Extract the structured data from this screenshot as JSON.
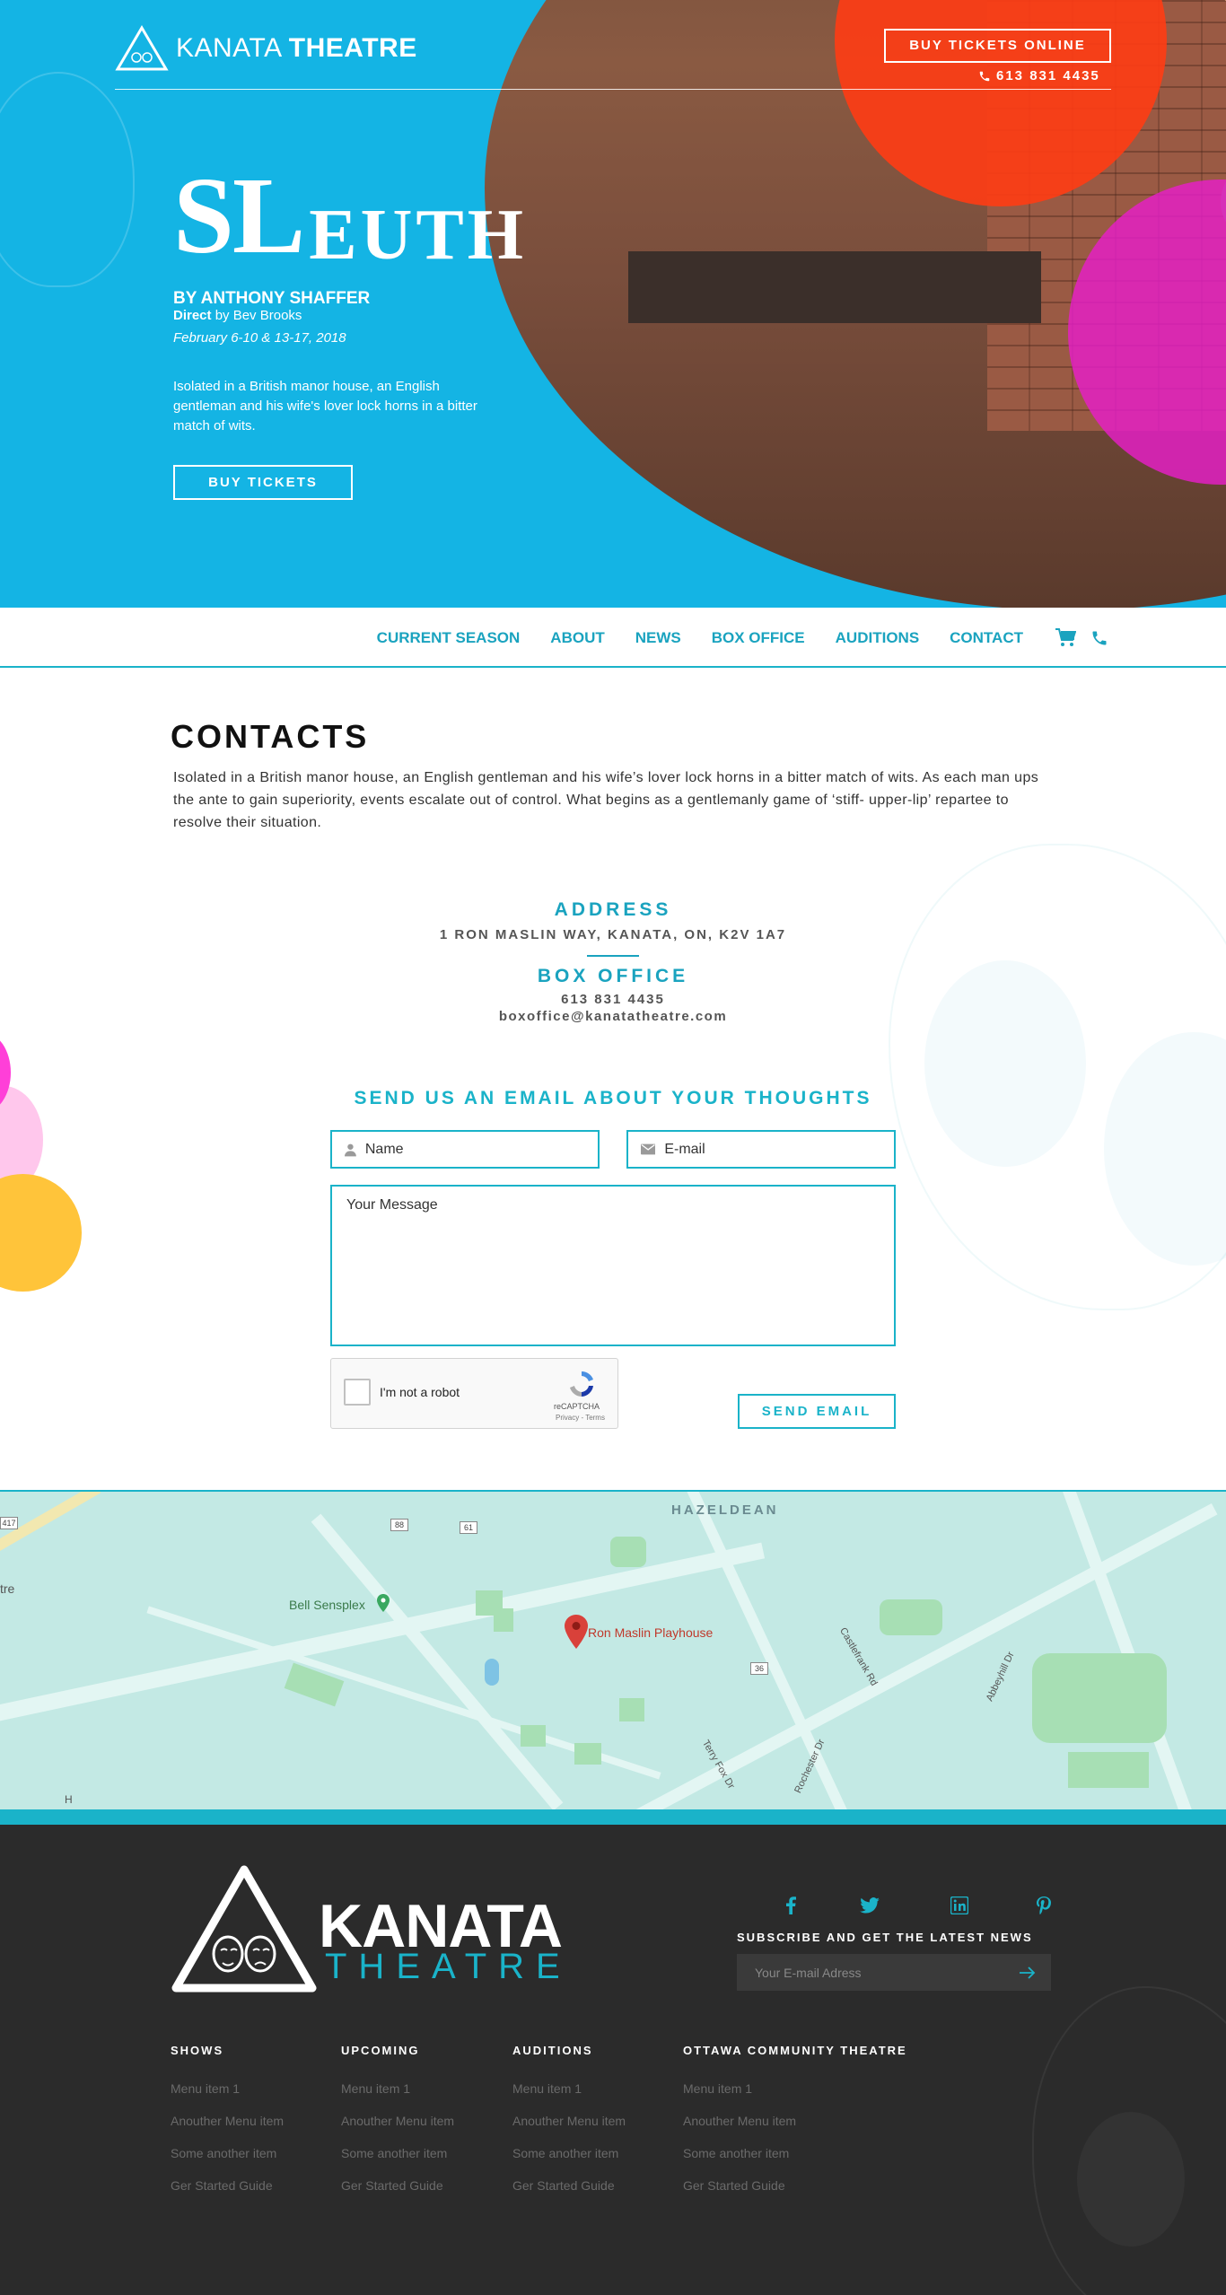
{
  "header": {
    "brand_light": "KANATA",
    "brand_bold": "THEATRE",
    "buy_online_label": "BUY TICKETS ONLINE",
    "phone": "613 831 4435"
  },
  "hero": {
    "title_first": "S",
    "title_second": "L",
    "title_rest": "EUTH",
    "by_line": "BY ANTHONY SHAFFER",
    "director_label": "Direct",
    "director_name": "by Bev Brooks",
    "dates": "February 6-10 & 13-17, 2018",
    "blurb": "Isolated in a British manor house, an English gentleman and his wife's lover lock horns in a bitter match of wits.",
    "buy_label": "BUY TICKETS"
  },
  "nav": {
    "items": [
      "CURRENT SEASON",
      "ABOUT",
      "NEWS",
      "BOX OFFICE",
      "AUDITIONS",
      "CONTACT"
    ],
    "icons": [
      "cart-icon",
      "phone-icon"
    ]
  },
  "contacts": {
    "title": "CONTACTS",
    "text": "Isolated in a British manor house, an English gentleman and his wife’s lover lock horns in a bitter match of wits. As each man ups the ante to gain superiority, events escalate out of control. What begins as a gentlemanly game of ‘stiff- upper-lip’ repartee to resolve their situation.",
    "address_label": "ADDRESS",
    "address_value": "1 RON MASLIN WAY, KANATA, ON, K2V 1A7",
    "box_office_label": "BOX OFFICE",
    "box_office_phone": "613 831 4435",
    "box_office_email": "boxoffice@kanatatheatre.com"
  },
  "form": {
    "title": "SEND US AN EMAIL ABOUT YOUR THOUGHTS",
    "name_placeholder": "Name",
    "email_placeholder": "E-mail",
    "message_placeholder": "Your Message",
    "captcha_label": "I'm not a robot",
    "captcha_brand": "reCAPTCHA",
    "captcha_terms": "Privacy - Terms",
    "send_label": "SEND EMAIL"
  },
  "map": {
    "area_label": "HAZELDEAN",
    "place_label": "Ron Maslin Playhouse",
    "poi_label": "Bell Sensplex",
    "left_edge_label": "tre",
    "routes": [
      "417",
      "88",
      "61",
      "36"
    ],
    "streets": [
      "Castlefrank Rd",
      "Abbeyhill Dr",
      "Terry Fox Dr",
      "Rochester Dr"
    ],
    "edge_letter": "H"
  },
  "footer": {
    "logo_kanata": "KANATA",
    "logo_theatre": "THEATRE",
    "social_icons": [
      "facebook-icon",
      "twitter-icon",
      "linkedin-icon",
      "pinterest-icon"
    ],
    "subscribe_title": "SUBSCRIBE AND GET THE LATEST NEWS",
    "subscribe_placeholder": "Your E-mail Adress",
    "columns": [
      {
        "title": "SHOWS",
        "items": [
          "Menu item 1",
          "Anouther Menu item",
          "Some another item",
          "Ger Started Guide"
        ]
      },
      {
        "title": "UPCOMING",
        "items": [
          "Menu item 1",
          "Anouther Menu item",
          "Some another item",
          "Ger Started Guide"
        ]
      },
      {
        "title": "AUDITIONS",
        "items": [
          "Menu item 1",
          "Anouther Menu item",
          "Some another item",
          "Ger Started Guide"
        ]
      },
      {
        "title": "OTTAWA COMMUNITY THEATRE",
        "items": [
          "Menu item 1",
          "Anouther Menu item",
          "Some another item",
          "Ger Started Guide"
        ]
      }
    ]
  },
  "colors": {
    "accent": "#1ab3c9",
    "hero_blue": "#14b4e4",
    "footer_bg": "#2b2b2b",
    "orange": "#ff3c14",
    "magenta": "#e61ec8",
    "yellow": "#ffc43a"
  }
}
